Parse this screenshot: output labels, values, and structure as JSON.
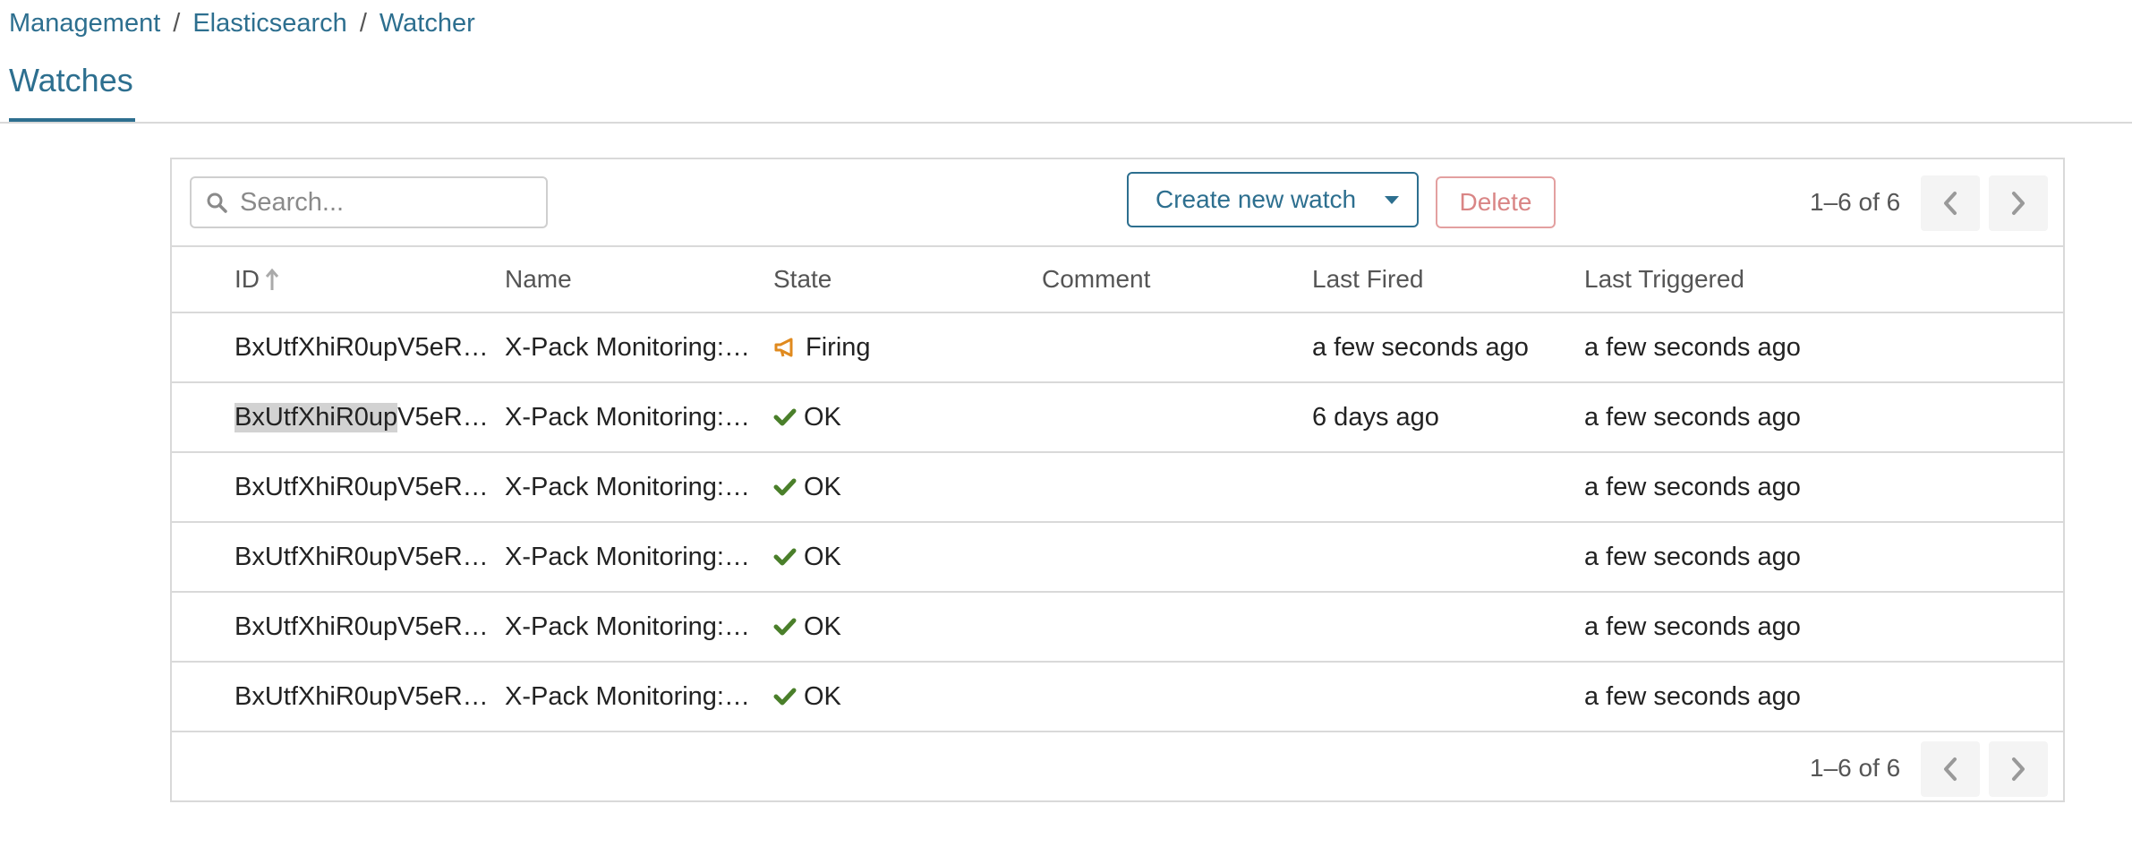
{
  "breadcrumb": {
    "items": [
      "Management",
      "Elasticsearch",
      "Watcher"
    ],
    "separator": "/"
  },
  "tabs": {
    "active": "Watches"
  },
  "toolbar": {
    "search_placeholder": "Search...",
    "search_value": "",
    "create_label": "Create new watch",
    "delete_label": "Delete",
    "pager_text": "1–6 of 6"
  },
  "table": {
    "columns": {
      "id": "ID",
      "name": "Name",
      "state": "State",
      "comment": "Comment",
      "last_fired": "Last Fired",
      "last_triggered": "Last Triggered"
    },
    "sort": {
      "column": "id",
      "direction": "asc"
    },
    "rows": [
      {
        "id_hl": "",
        "id_rest": "BxUtfXhiR0upV5eR…",
        "name": "X-Pack Monitoring:…",
        "state": "Firing",
        "state_icon": "megaphone-icon",
        "comment": "",
        "last_fired": "a few seconds ago",
        "last_triggered": "a few seconds ago"
      },
      {
        "id_hl": "BxUtfXhiR0up",
        "id_rest": "V5eR…",
        "name": "X-Pack Monitoring:…",
        "state": "OK",
        "state_icon": "check-icon",
        "comment": "",
        "last_fired": "6 days ago",
        "last_triggered": "a few seconds ago"
      },
      {
        "id_hl": "",
        "id_rest": "BxUtfXhiR0upV5eR…",
        "name": "X-Pack Monitoring:…",
        "state": "OK",
        "state_icon": "check-icon",
        "comment": "",
        "last_fired": "",
        "last_triggered": "a few seconds ago"
      },
      {
        "id_hl": "",
        "id_rest": "BxUtfXhiR0upV5eR…",
        "name": "X-Pack Monitoring:…",
        "state": "OK",
        "state_icon": "check-icon",
        "comment": "",
        "last_fired": "",
        "last_triggered": "a few seconds ago"
      },
      {
        "id_hl": "",
        "id_rest": "BxUtfXhiR0upV5eR…",
        "name": "X-Pack Monitoring:…",
        "state": "OK",
        "state_icon": "check-icon",
        "comment": "",
        "last_fired": "",
        "last_triggered": "a few seconds ago"
      },
      {
        "id_hl": "",
        "id_rest": "BxUtfXhiR0upV5eR…",
        "name": "X-Pack Monitoring:…",
        "state": "OK",
        "state_icon": "check-icon",
        "comment": "",
        "last_fired": "",
        "last_triggered": "a few seconds ago"
      }
    ]
  },
  "footer": {
    "pager_text": "1–6 of 6"
  },
  "colors": {
    "accent": "#2d6f8f",
    "danger": "#d98585",
    "ok": "#4a7f2a",
    "firing": "#e08a1e",
    "border": "#d9d9d9"
  }
}
